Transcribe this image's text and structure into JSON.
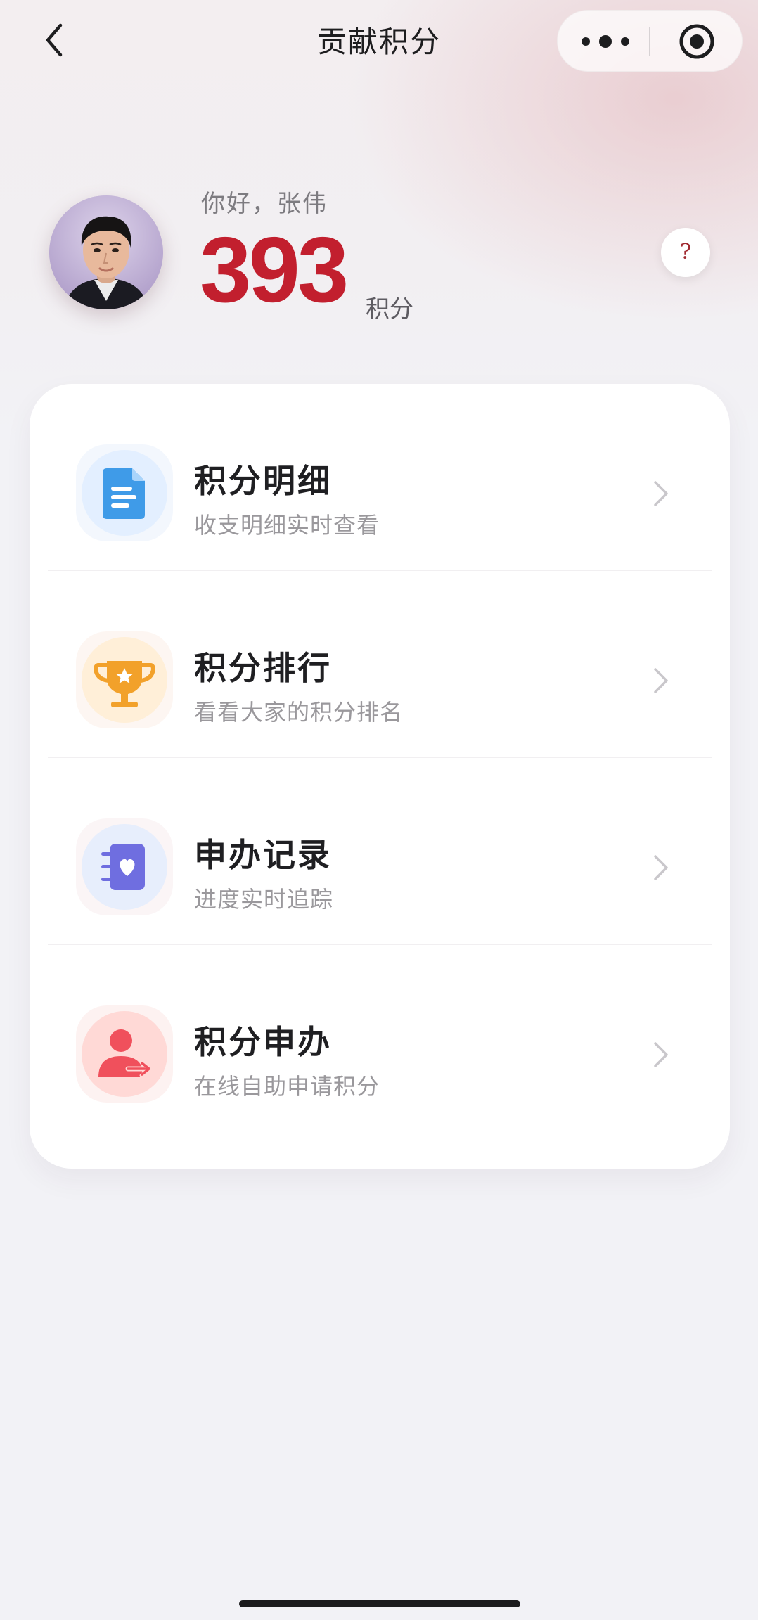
{
  "nav": {
    "title": "贡献积分",
    "back_icon": "chevron-left-icon",
    "more_icon": "more-dots-icon",
    "close_icon": "target-circle-icon"
  },
  "profile": {
    "greeting": "你好，张伟",
    "points": "393",
    "points_unit": "积分",
    "help_label": "?"
  },
  "menu": {
    "items": [
      {
        "title": "积分明细",
        "subtitle": "收支明细实时查看",
        "icon": "document-icon",
        "color": "#3f9be8"
      },
      {
        "title": "积分排行",
        "subtitle": "看看大家的积分排名",
        "icon": "trophy-icon",
        "color": "#f2a12a"
      },
      {
        "title": "申办记录",
        "subtitle": "进度实时追踪",
        "icon": "notebook-heart-icon",
        "color": "#6f6ee0"
      },
      {
        "title": "积分申办",
        "subtitle": "在线自助申请积分",
        "icon": "user-transfer-icon",
        "color": "#f0505c"
      }
    ]
  },
  "colors": {
    "accent_red": "#c21f2e",
    "background": "#f2f2f6"
  }
}
